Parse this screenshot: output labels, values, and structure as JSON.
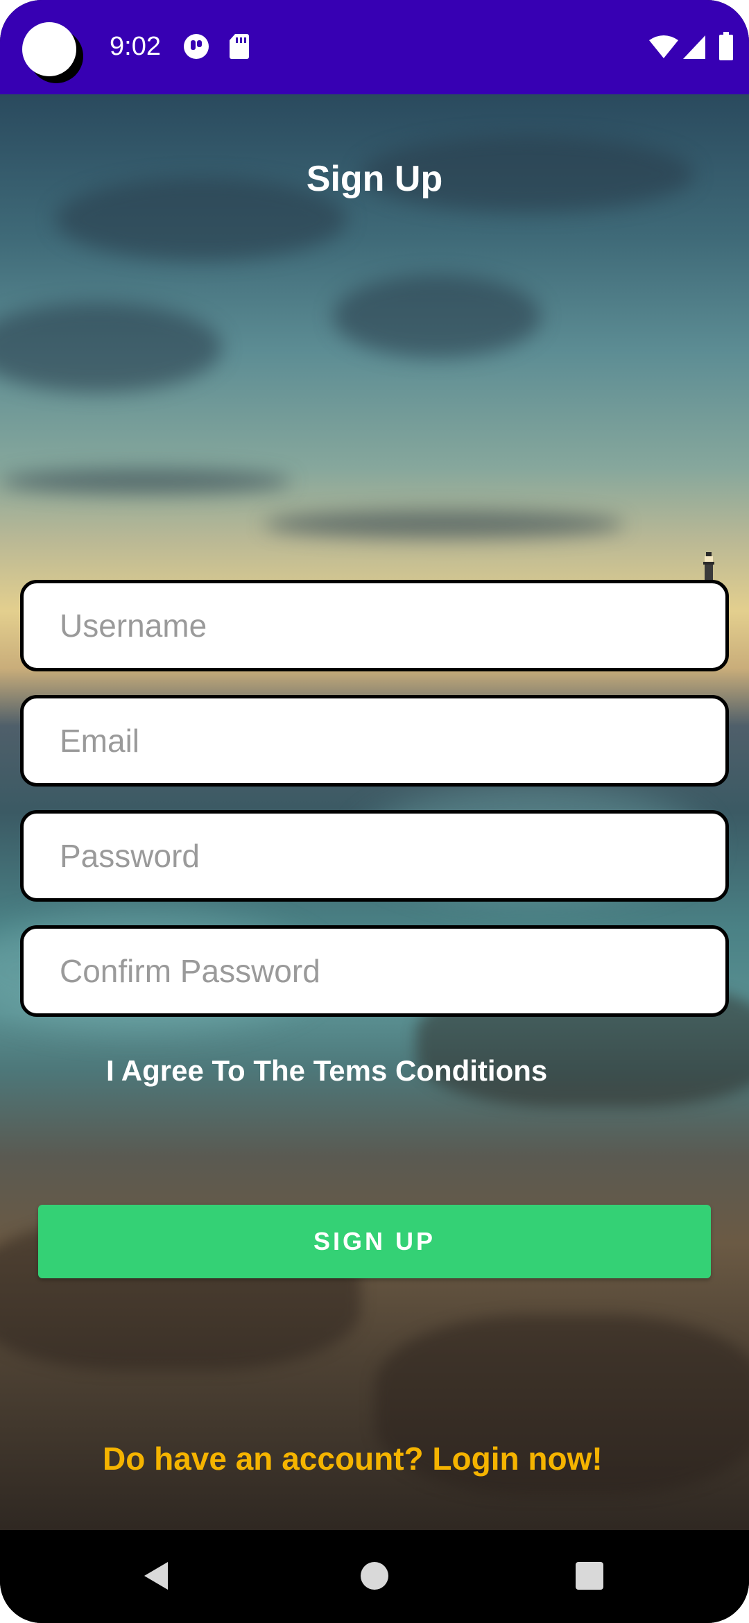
{
  "status_bar": {
    "time": "9:02",
    "icons": [
      "camera-cutout",
      "notification-icon",
      "sd-card-icon",
      "wifi-icon",
      "cell-signal-icon",
      "battery-icon"
    ]
  },
  "screen": {
    "title": "Sign Up"
  },
  "form": {
    "username_placeholder": "Username",
    "email_placeholder": "Email",
    "password_placeholder": "Password",
    "confirm_placeholder": "Confirm Password",
    "agree_text": "I Agree To The Tems Conditions",
    "submit_label": "SIGN UP"
  },
  "footer": {
    "login_link": "Do have an account? Login now!"
  },
  "colors": {
    "status_bar": "#3700b3",
    "button": "#34d175",
    "link": "#f5b400"
  },
  "nav": {
    "icons": [
      "back-icon",
      "home-icon",
      "recents-icon"
    ]
  }
}
